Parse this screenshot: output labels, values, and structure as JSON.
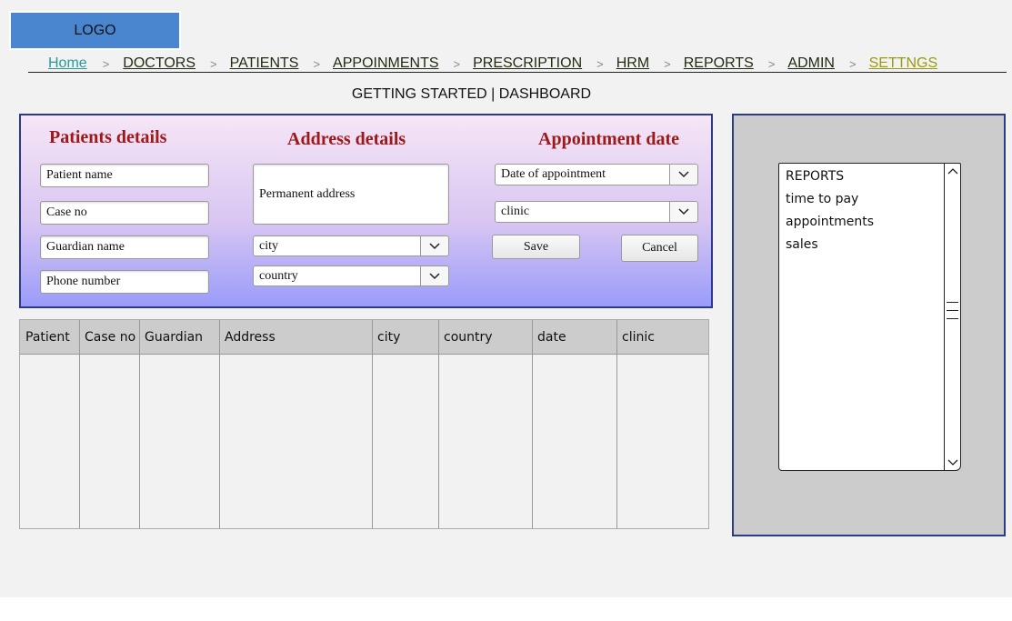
{
  "logo": {
    "text": "LOGO"
  },
  "nav": {
    "items": [
      "Home",
      "DOCTORS",
      "PATIENTS",
      "APPOINMENTS",
      "PRESCRIPTION",
      "HRM",
      "REPORTS",
      "ADMIN",
      "SETTNGS"
    ],
    "separator": ">"
  },
  "subtitle": "GETTING STARTED | DASHBOARD",
  "form": {
    "patients_title": "Patients details",
    "address_title": "Address details",
    "appointment_title": "Appointment date",
    "patient_name": "Patient name",
    "case_no": "Case no",
    "guardian_name": "Guardian name",
    "phone_number": "Phone number",
    "permanent_address": "Permanent address",
    "city": "city",
    "country": "country",
    "date_of_appointment": "Date of appointment",
    "clinic": "clinic",
    "save": "Save",
    "cancel": "Cancel"
  },
  "table": {
    "columns": [
      "Patient",
      "Case no",
      "Guardian",
      "Address",
      "city",
      "country",
      "date",
      "clinic"
    ],
    "rows": []
  },
  "side_list": {
    "items": [
      "REPORTS",
      "time to pay",
      "appointments",
      "sales"
    ]
  },
  "colors": {
    "page_bg": "#f2f2f2",
    "logo_bg": "#4a86d0",
    "section_title": "#a01818",
    "panel_border": "#2b3a8a",
    "nav_home": "#2a9a9a",
    "nav_active": "#9a9a10",
    "table_header_bg": "#cccccc",
    "side_panel_bg": "#cccccc"
  },
  "icons": {
    "dropdown": "chevron-down-icon",
    "scroll_up": "chevron-up-icon",
    "scroll_down": "chevron-down-icon"
  }
}
